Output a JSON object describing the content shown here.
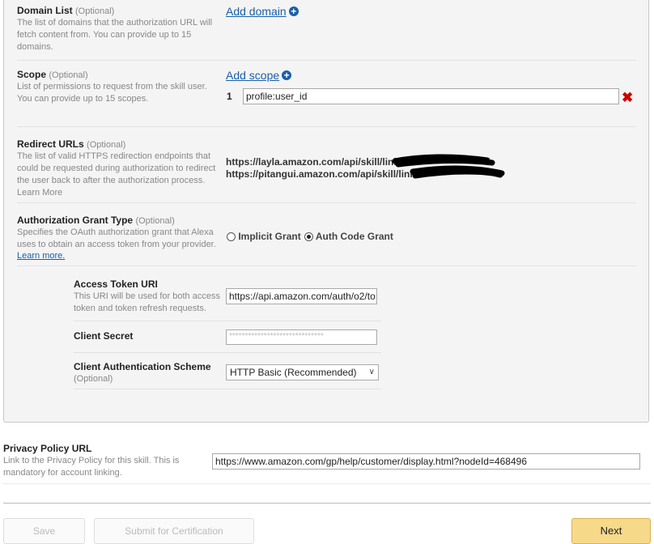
{
  "domain_list": {
    "title": "Domain List",
    "optional": "(Optional)",
    "description": "The list of domains that the authorization URL will fetch content from. You can provide up to 15 domains.",
    "add_label": "Add domain"
  },
  "scope": {
    "title": "Scope",
    "optional": "(Optional)",
    "description": "List of permissions to request from the skill user. You can provide up to 15 scopes.",
    "add_label": "Add scope",
    "items": [
      {
        "index": "1",
        "value": "profile:user_id"
      }
    ]
  },
  "redirect": {
    "title": "Redirect URLs",
    "optional": "(Optional)",
    "description": "The list of valid HTTPS redirection endpoints that could be requested during authorization to redirect the user back to after the authorization process.",
    "learn_more": "Learn More",
    "urls": [
      "https://layla.amazon.com/api/skill/link/",
      "https://pitangui.amazon.com/api/skill/link/"
    ]
  },
  "grant": {
    "title": "Authorization Grant Type",
    "optional": "(Optional)",
    "description": "Specifies the OAuth authorization grant that Alexa uses to obtain an access token from your provider.",
    "learn_more": "Learn more.",
    "options": [
      {
        "label": "Implicit Grant",
        "selected": false
      },
      {
        "label": "Auth Code Grant",
        "selected": true
      }
    ]
  },
  "access_token": {
    "title": "Access Token URI",
    "description": "This URI will be used for both access token and token refresh requests.",
    "value": "https://api.amazon.com/auth/o2/to"
  },
  "client_secret": {
    "title": "Client Secret",
    "value": "******************************"
  },
  "client_auth": {
    "title": "Client Authentication Scheme",
    "optional": "(Optional)",
    "value": "HTTP Basic (Recommended)"
  },
  "privacy": {
    "title": "Privacy Policy URL",
    "description": "Link to the Privacy Policy for this skill. This is mandatory for account linking.",
    "value": "https://www.amazon.com/gp/help/customer/display.html?nodeId=468496"
  },
  "buttons": {
    "save": "Save",
    "submit": "Submit for Certification",
    "next": "Next"
  },
  "colors": {
    "link": "#1a5fa8",
    "remove": "#cc0000",
    "next_bg": "#f7d98a"
  }
}
